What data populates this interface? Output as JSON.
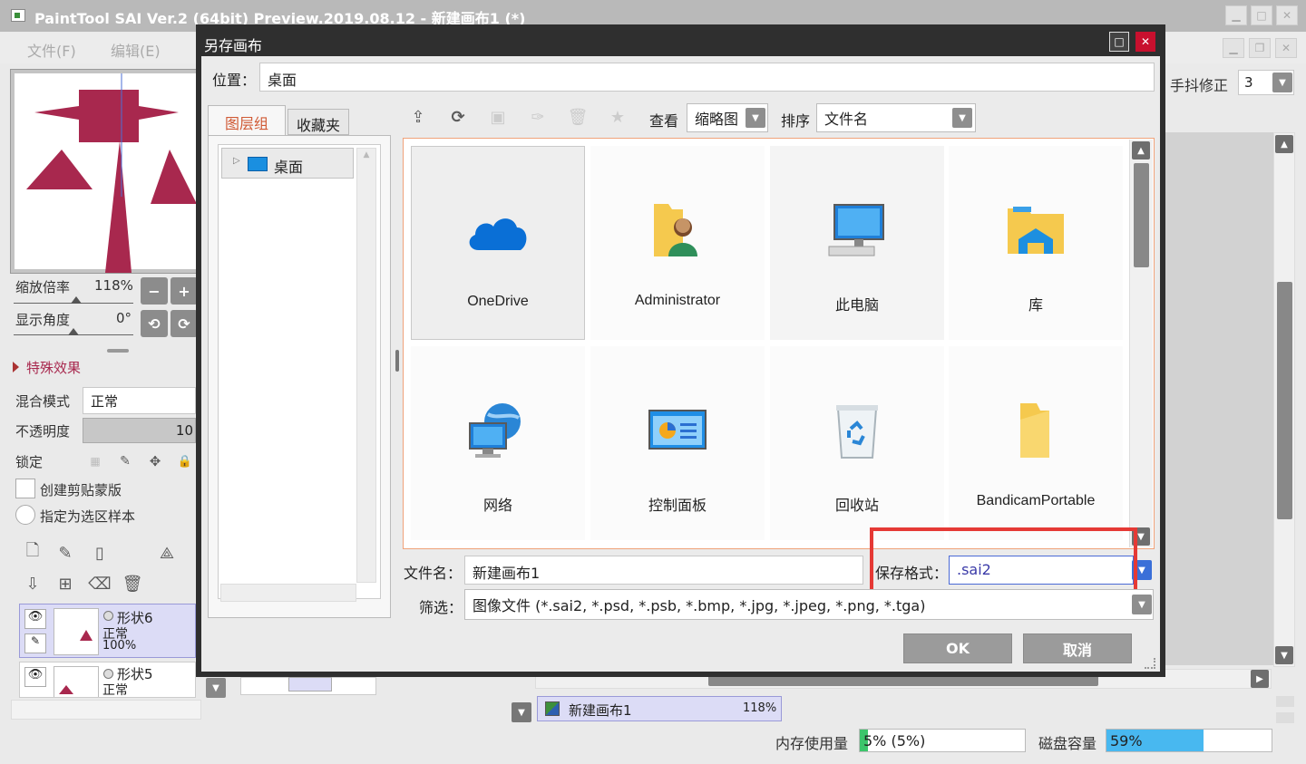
{
  "app": {
    "title": "PaintTool SAI Ver.2 (64bit) Preview.2019.08.12 - 新建画布1 (*)",
    "menu": [
      "文件(F)",
      "编辑(E)"
    ]
  },
  "left_panel": {
    "zoom_label": "缩放倍率",
    "zoom_value": "118%",
    "angle_label": "显示角度",
    "angle_value": "0°",
    "special_effects": "特殊效果",
    "blend_label": "混合模式",
    "blend_value": "正常",
    "opacity_label": "不透明度",
    "opacity_value": "10",
    "lock_label": "锁定",
    "clip_label": "创建剪贴蒙版",
    "selection_label": "指定为选区样本",
    "layers": [
      {
        "name": "形状6",
        "mode": "正常",
        "opacity": "100%"
      },
      {
        "name": "形状5",
        "mode": "正常"
      }
    ]
  },
  "right_panel": {
    "stabilizer_label": "手抖修正",
    "stabilizer_value": "3"
  },
  "status": {
    "canvas_tab": "新建画布1",
    "canvas_zoom": "118%",
    "memory_label": "内存使用量",
    "memory_value": "5% (5%)",
    "memory_fraction": 0.05,
    "disk_label": "磁盘容量",
    "disk_value": "59%",
    "disk_fraction": 0.59
  },
  "dialog": {
    "title": "另存画布",
    "location_label": "位置：",
    "location_value": "桌面",
    "tabs": [
      "图层组",
      "收藏夹"
    ],
    "tree": [
      "桌面"
    ],
    "view_label": "查看",
    "view_value": "缩略图",
    "sort_label": "排序",
    "sort_value": "文件名",
    "items": [
      {
        "label": "OneDrive",
        "icon": "onedrive-icon"
      },
      {
        "label": "Administrator",
        "icon": "user-folder-icon"
      },
      {
        "label": "此电脑",
        "icon": "computer-icon"
      },
      {
        "label": "库",
        "icon": "library-icon"
      },
      {
        "label": "网络",
        "icon": "network-icon"
      },
      {
        "label": "控制面板",
        "icon": "control-panel-icon"
      },
      {
        "label": "回收站",
        "icon": "recycle-bin-icon"
      },
      {
        "label": "BandicamPortable",
        "icon": "folder-icon"
      }
    ],
    "filename_label": "文件名：",
    "filename_value": "新建画布1",
    "format_label": "保存格式：",
    "format_value": ".sai2",
    "filter_label": "筛选：",
    "filter_value": "图像文件 (*.sai2, *.psd, *.psb, *.bmp, *.jpg, *.jpeg, *.png, *.tga)",
    "ok_label": "OK",
    "cancel_label": "取消"
  },
  "colors": {
    "highlight": "#e53935",
    "accent": "#a8284e",
    "selection": "#dcdcf6"
  }
}
